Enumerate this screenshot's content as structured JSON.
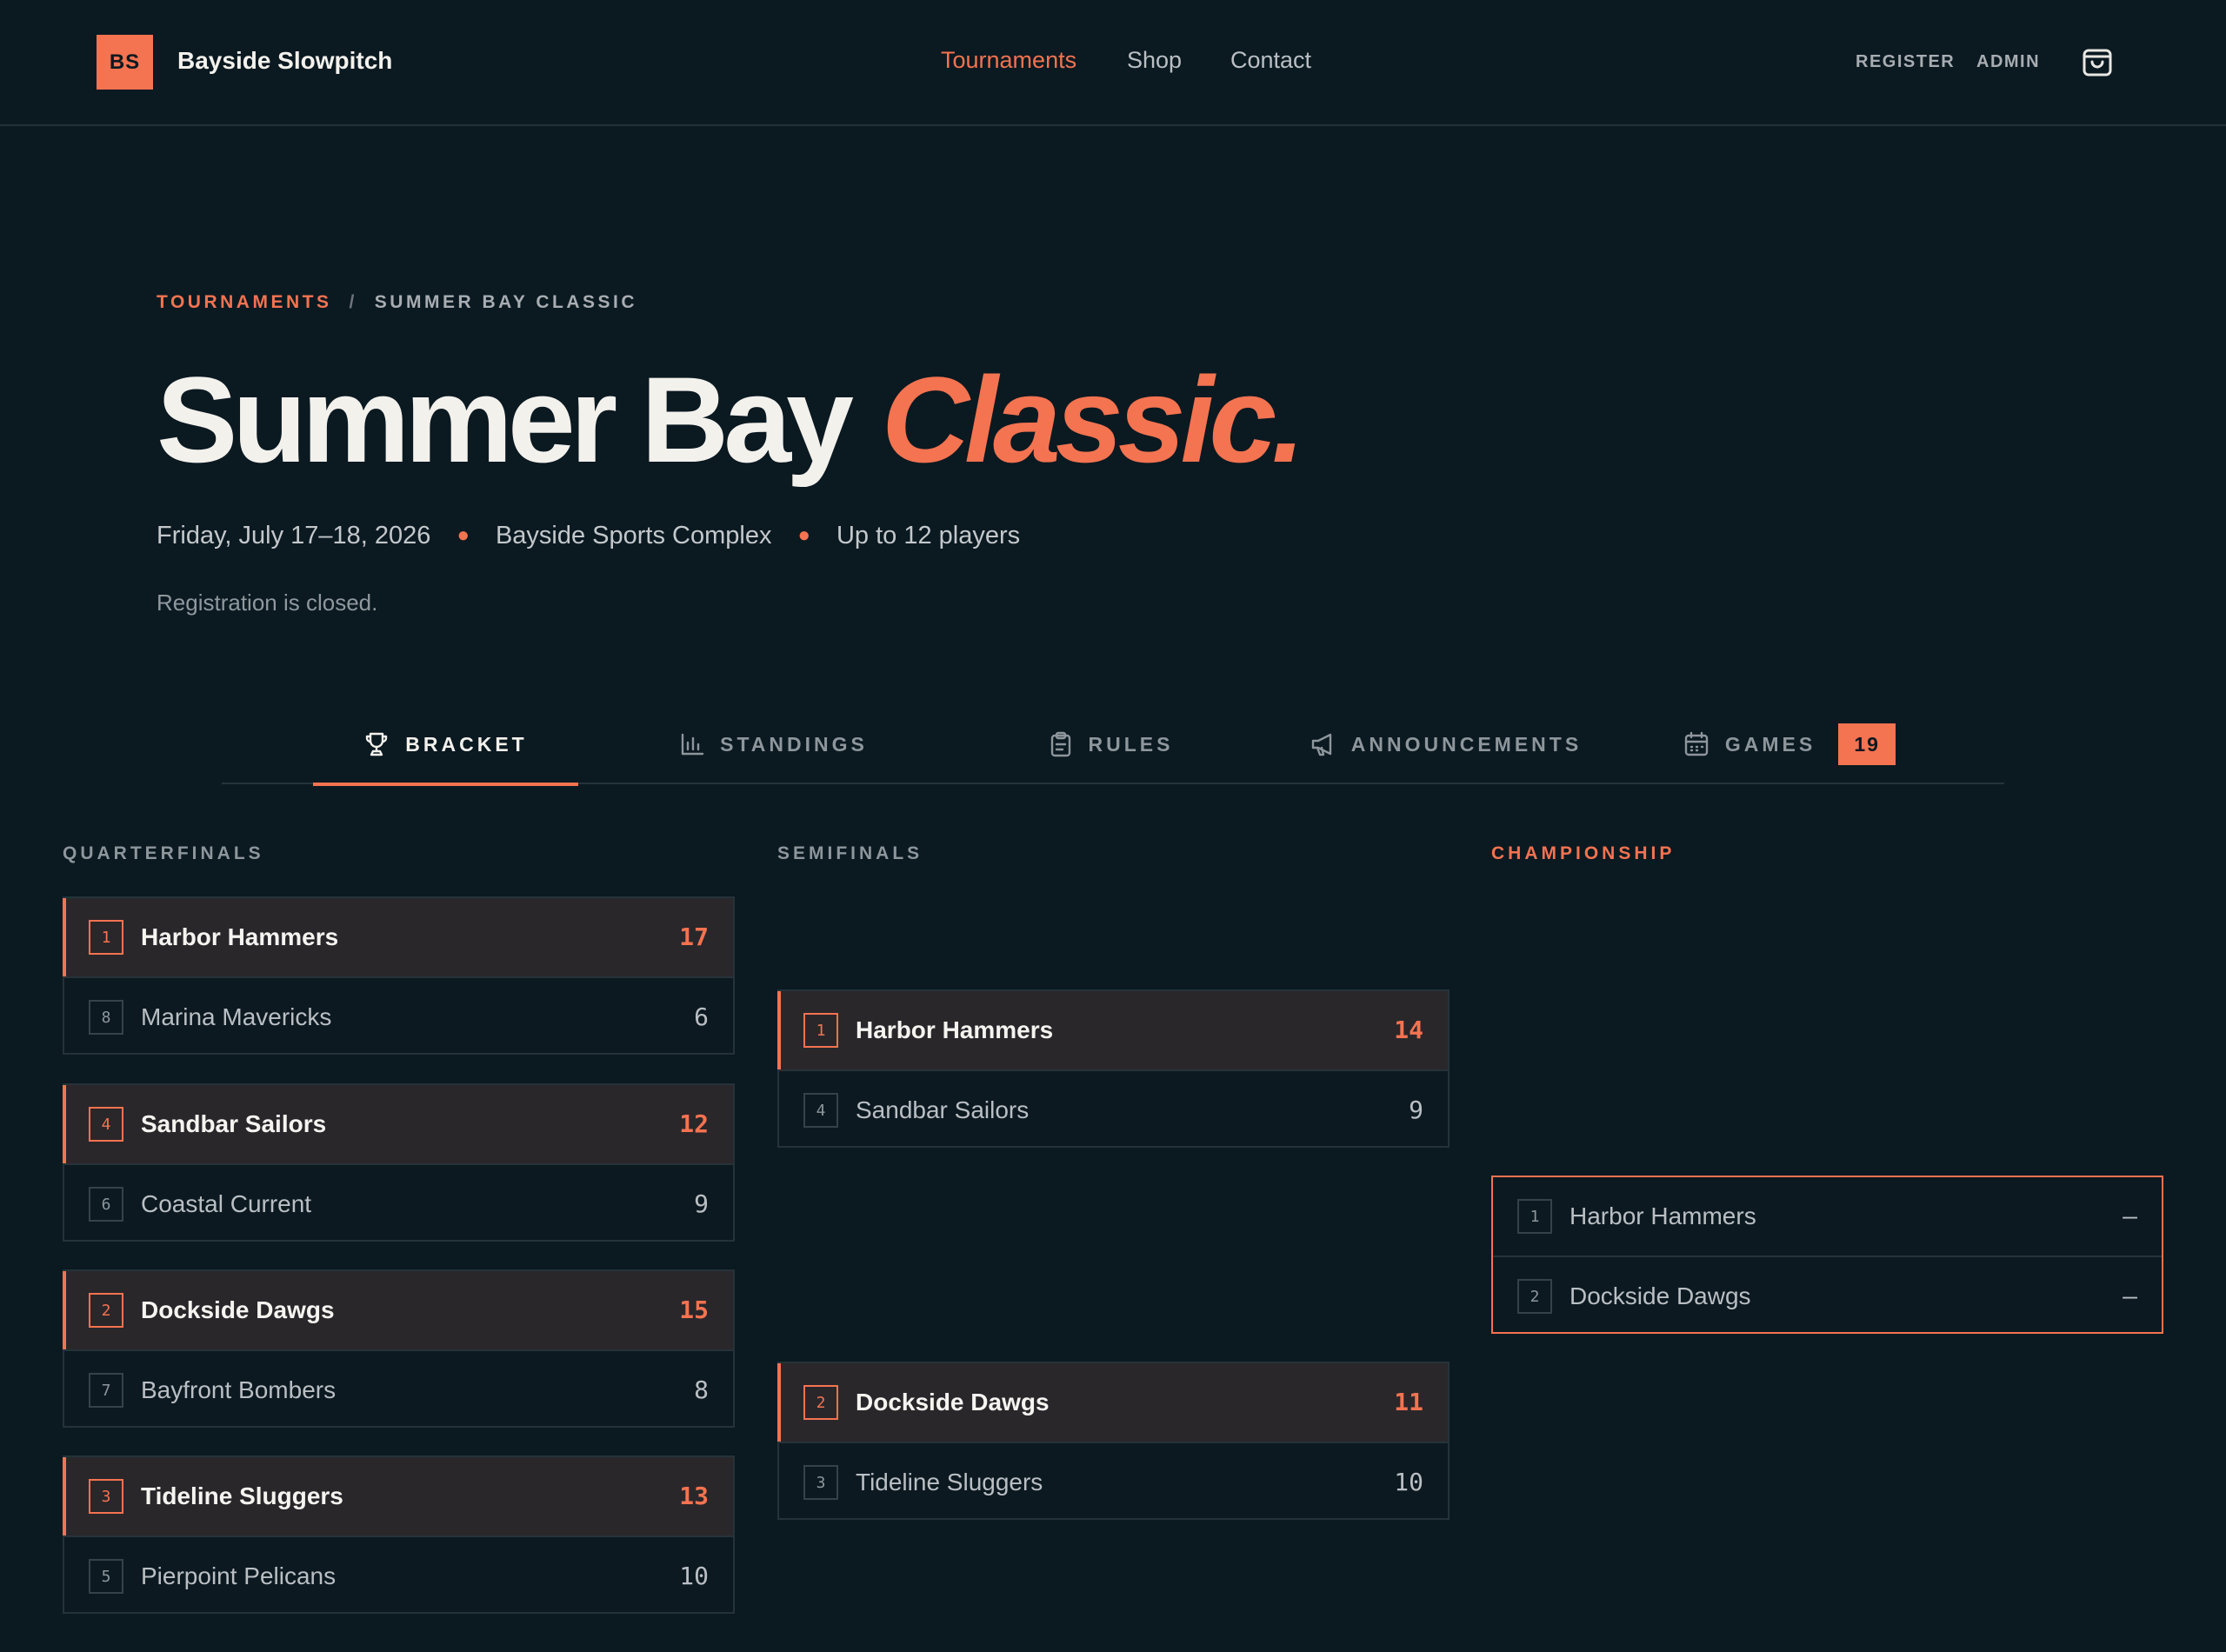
{
  "header": {
    "logo_initials": "BS",
    "brand": "Bayside Slowpitch",
    "nav": [
      "Tournaments",
      "Shop",
      "Contact"
    ],
    "register": "REGISTER",
    "admin": "ADMIN",
    "cart_icon": "shopping-bag-icon"
  },
  "breadcrumb": {
    "parent": "TOURNAMENTS",
    "separator": "/",
    "current": "SUMMER BAY CLASSIC"
  },
  "hero": {
    "title_main": "Summer Bay",
    "title_accent": "Classic.",
    "date": "Friday, July 17–18, 2026",
    "venue": "Bayside Sports Complex",
    "capacity": "Up to 12 players",
    "registration_status": "Registration is closed."
  },
  "tabs": [
    {
      "label": "BRACKET",
      "icon": "trophy-icon",
      "active": true
    },
    {
      "label": "STANDINGS",
      "icon": "bar-chart-icon"
    },
    {
      "label": "RULES",
      "icon": "clipboard-icon"
    },
    {
      "label": "ANNOUNCEMENTS",
      "icon": "megaphone-icon"
    },
    {
      "label": "GAMES",
      "icon": "calendar-icon",
      "badge": "19"
    }
  ],
  "bracket": {
    "quarterfinals": {
      "label": "QUARTERFINALS",
      "matches": [
        {
          "teams": [
            {
              "seed": "1",
              "name": "Harbor Hammers",
              "score": "17",
              "win": true
            },
            {
              "seed": "8",
              "name": "Marina Mavericks",
              "score": "6"
            }
          ]
        },
        {
          "teams": [
            {
              "seed": "4",
              "name": "Sandbar Sailors",
              "score": "12",
              "win": true
            },
            {
              "seed": "6",
              "name": "Coastal Current",
              "score": "9"
            }
          ]
        },
        {
          "teams": [
            {
              "seed": "2",
              "name": "Dockside Dawgs",
              "score": "15",
              "win": true
            },
            {
              "seed": "7",
              "name": "Bayfront Bombers",
              "score": "8"
            }
          ]
        },
        {
          "teams": [
            {
              "seed": "3",
              "name": "Tideline Sluggers",
              "score": "13",
              "win": true
            },
            {
              "seed": "5",
              "name": "Pierpoint Pelicans",
              "score": "10"
            }
          ]
        }
      ]
    },
    "semifinals": {
      "label": "SEMIFINALS",
      "matches": [
        {
          "teams": [
            {
              "seed": "1",
              "name": "Harbor Hammers",
              "score": "14",
              "win": true
            },
            {
              "seed": "4",
              "name": "Sandbar Sailors",
              "score": "9"
            }
          ]
        },
        {
          "teams": [
            {
              "seed": "2",
              "name": "Dockside Dawgs",
              "score": "11",
              "win": true
            },
            {
              "seed": "3",
              "name": "Tideline Sluggers",
              "score": "10"
            }
          ]
        }
      ]
    },
    "championship": {
      "label": "CHAMPIONSHIP",
      "matches": [
        {
          "teams": [
            {
              "seed": "1",
              "name": "Harbor Hammers",
              "score": "–"
            },
            {
              "seed": "2",
              "name": "Dockside Dawgs",
              "score": "–"
            }
          ]
        }
      ]
    }
  },
  "colors": {
    "background": "#0b1921",
    "accent": "#f47350",
    "winner_row": "#2a272b",
    "border": "#253239"
  }
}
